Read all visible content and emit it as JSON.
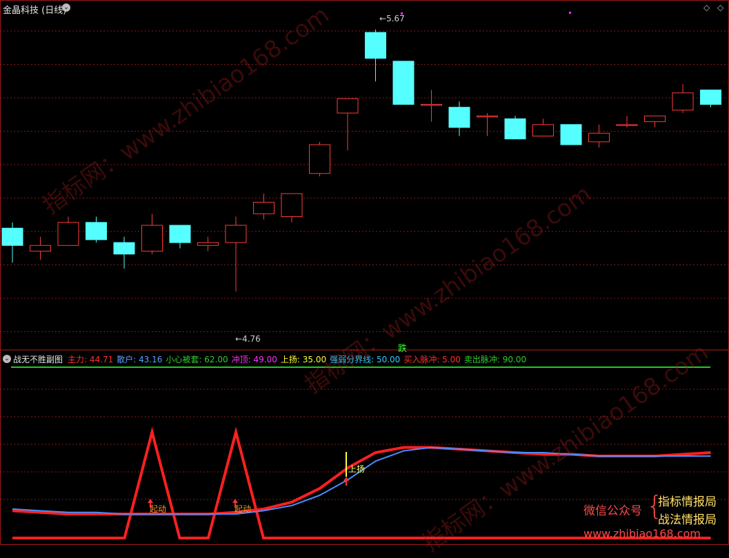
{
  "main_panel": {
    "title": "金晶科技",
    "period": "(日线)",
    "high_label": "5.67",
    "low_label": "4.76",
    "signal_label": "跌"
  },
  "sub_panel": {
    "title": "战无不胜副图",
    "legend": [
      {
        "label": "主力:",
        "value": "44.71",
        "color": "#ff3030"
      },
      {
        "label": "散户:",
        "value": "43.16",
        "color": "#5aa0ff"
      },
      {
        "label": "小心被套:",
        "value": "62.00",
        "color": "#33cc33"
      },
      {
        "label": "冲顶:",
        "value": "49.00",
        "color": "#ff33ff"
      },
      {
        "label": "上扬:",
        "value": "35.00",
        "color": "#ffff33"
      },
      {
        "label": "强弱分界线:",
        "value": "50.00",
        "color": "#33ccff"
      },
      {
        "label": "买入脉冲:",
        "value": "5.00",
        "color": "#ff3030"
      },
      {
        "label": "卖出脉冲:",
        "value": "90.00",
        "color": "#33cc33"
      }
    ],
    "annotations": {
      "qidong": "起动",
      "shangyang": "上扬"
    }
  },
  "watermark": "指标网：www.zhibiao168.com",
  "promo": {
    "wechat": "微信公众号",
    "brand1": "指标情报局",
    "brand2": "战法情报局",
    "url": "www.zhibiao168.com"
  },
  "colors": {
    "up_candle": "#ff3b3b",
    "down_candle": "#55ffff",
    "grid": "#8a1a1a",
    "main_line": "#ff2020",
    "retail_line": "#4a8cff",
    "top_line": "#22cc22"
  },
  "chart_data": [
    {
      "type": "candlestick",
      "title": "金晶科技 (日线)",
      "ylim": [
        4.6,
        5.72
      ],
      "candles": [
        {
          "o": 4.98,
          "h": 5.0,
          "l": 4.86,
          "c": 4.92
        },
        {
          "o": 4.9,
          "h": 4.95,
          "l": 4.87,
          "c": 4.92
        },
        {
          "o": 4.92,
          "h": 5.02,
          "l": 4.92,
          "c": 5.0
        },
        {
          "o": 5.0,
          "h": 5.02,
          "l": 4.93,
          "c": 4.94
        },
        {
          "o": 4.93,
          "h": 4.95,
          "l": 4.84,
          "c": 4.89
        },
        {
          "o": 4.9,
          "h": 5.03,
          "l": 4.89,
          "c": 4.99
        },
        {
          "o": 4.99,
          "h": 4.99,
          "l": 4.91,
          "c": 4.93
        },
        {
          "o": 4.92,
          "h": 4.95,
          "l": 4.9,
          "c": 4.93
        },
        {
          "o": 4.93,
          "h": 5.02,
          "l": 4.76,
          "c": 4.99
        },
        {
          "o": 5.03,
          "h": 5.1,
          "l": 5.01,
          "c": 5.07
        },
        {
          "o": 5.02,
          "h": 5.1,
          "l": 5.0,
          "c": 5.1
        },
        {
          "o": 5.17,
          "h": 5.28,
          "l": 5.16,
          "c": 5.27
        },
        {
          "o": 5.38,
          "h": 5.43,
          "l": 5.25,
          "c": 5.43
        },
        {
          "o": 5.66,
          "h": 5.67,
          "l": 5.49,
          "c": 5.57
        },
        {
          "o": 5.56,
          "h": 5.56,
          "l": 5.41,
          "c": 5.41
        },
        {
          "o": 5.41,
          "h": 5.46,
          "l": 5.35,
          "c": 5.41
        },
        {
          "o": 5.4,
          "h": 5.42,
          "l": 5.3,
          "c": 5.33
        },
        {
          "o": 5.37,
          "h": 5.38,
          "l": 5.3,
          "c": 5.37
        },
        {
          "o": 5.36,
          "h": 5.37,
          "l": 5.29,
          "c": 5.29
        },
        {
          "o": 5.3,
          "h": 5.36,
          "l": 5.3,
          "c": 5.34
        },
        {
          "o": 5.34,
          "h": 5.34,
          "l": 5.27,
          "c": 5.27
        },
        {
          "o": 5.28,
          "h": 5.34,
          "l": 5.26,
          "c": 5.31
        },
        {
          "o": 5.34,
          "h": 5.37,
          "l": 5.33,
          "c": 5.34
        },
        {
          "o": 5.35,
          "h": 5.37,
          "l": 5.33,
          "c": 5.37
        },
        {
          "o": 5.39,
          "h": 5.48,
          "l": 5.38,
          "c": 5.45
        },
        {
          "o": 5.46,
          "h": 5.46,
          "l": 5.4,
          "c": 5.41
        }
      ]
    },
    {
      "type": "line",
      "title": "战无不胜副图",
      "ylim": [
        0,
        100
      ],
      "series": [
        {
          "name": "主力",
          "values": [
            16,
            15,
            14,
            14,
            14,
            14,
            14,
            14,
            15,
            17,
            21,
            29,
            41,
            50,
            53,
            53,
            52,
            51,
            50,
            49,
            49,
            48,
            48,
            48,
            49,
            50
          ]
        },
        {
          "name": "散户",
          "values": [
            17,
            16,
            15,
            15,
            14,
            14,
            14,
            14,
            14,
            16,
            19,
            25,
            34,
            45,
            51,
            53,
            52,
            51,
            50,
            50,
            49,
            48,
            48,
            48,
            48,
            48
          ]
        },
        {
          "name": "小心被套",
          "values": [
            97,
            97,
            97,
            97,
            97,
            97,
            97,
            97,
            97,
            97,
            97,
            97,
            97,
            97,
            97,
            97,
            97,
            97,
            97,
            97,
            97,
            97,
            97,
            97,
            97,
            97
          ]
        },
        {
          "name": "脉冲",
          "values": [
            0,
            0,
            0,
            0,
            0,
            62,
            0,
            0,
            62,
            0,
            0,
            0,
            0,
            0,
            0,
            0,
            0,
            0,
            0,
            0,
            0,
            0,
            0,
            0,
            0,
            0
          ]
        }
      ]
    }
  ]
}
